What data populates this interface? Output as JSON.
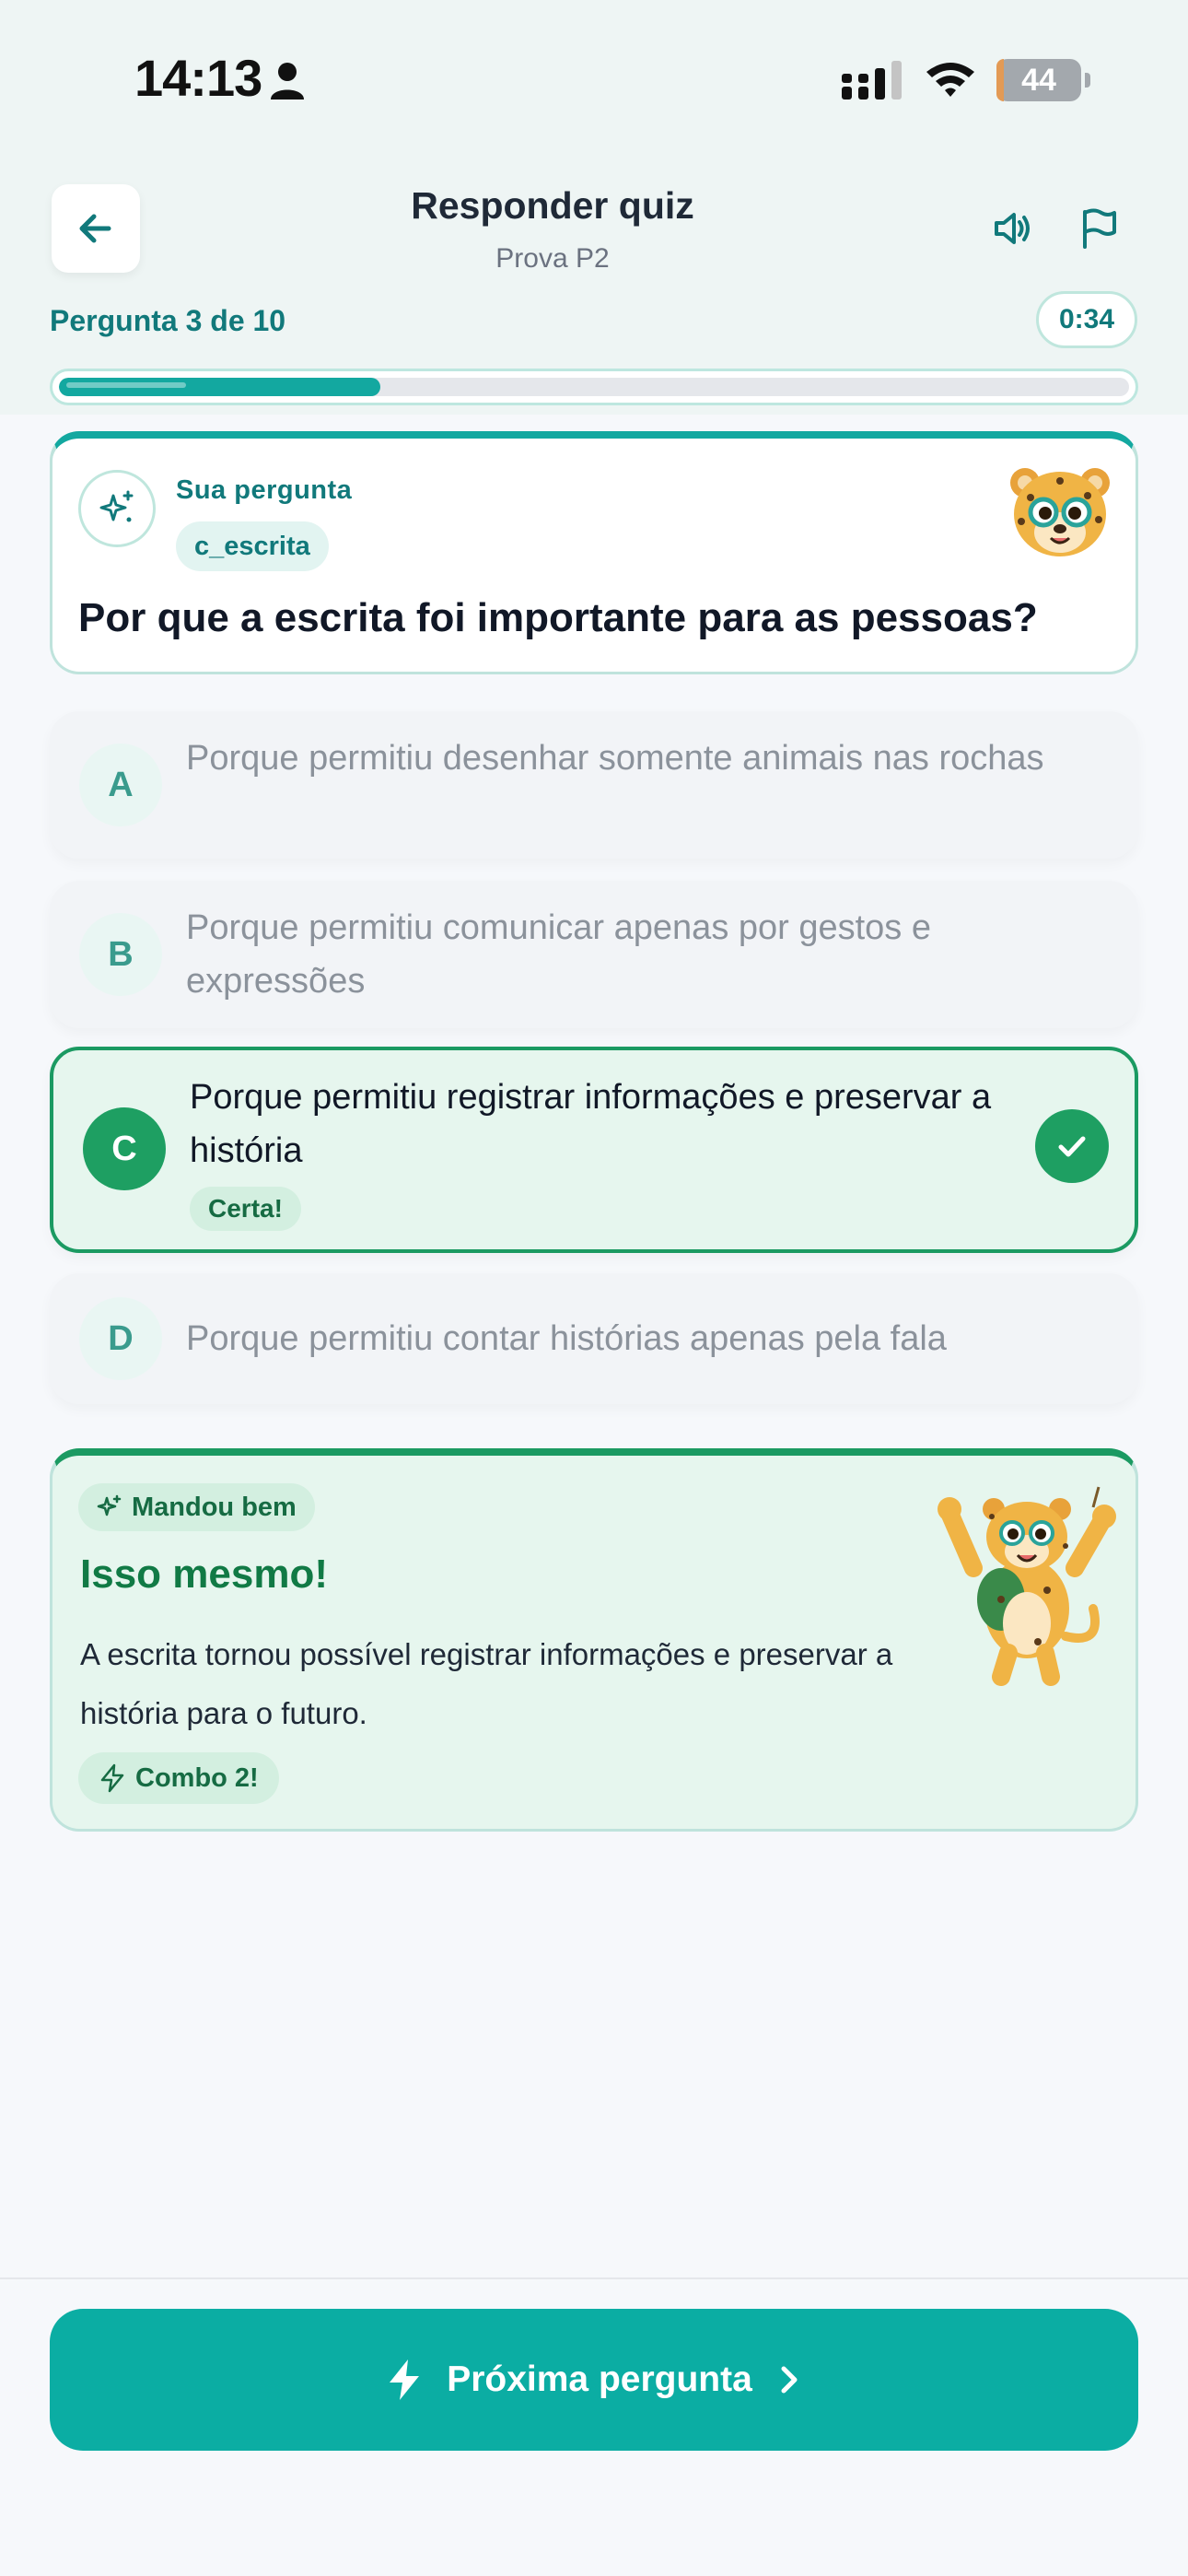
{
  "status_bar": {
    "time": "14:13",
    "battery": "44"
  },
  "header": {
    "title": "Responder quiz",
    "subtitle": "Prova P2",
    "progress_label": "Pergunta 3 de 10",
    "timer": "0:34",
    "progress_fraction": 0.3
  },
  "question": {
    "kicker": "Sua pergunta",
    "tag": "c_escrita",
    "text": "Por que a escrita foi importante para as pessoas?"
  },
  "options": [
    {
      "letter": "A",
      "text": "Porque permitiu desenhar somente animais nas rochas"
    },
    {
      "letter": "B",
      "text": "Porque permitiu comunicar apenas por gestos e expressões"
    },
    {
      "letter": "C",
      "text": "Porque permitiu registrar informações e preservar a história",
      "badge": "Certa!"
    },
    {
      "letter": "D",
      "text": "Porque permitiu contar histórias apenas pela fala"
    }
  ],
  "feedback": {
    "kicker": "Mandou bem",
    "title": "Isso mesmo!",
    "text": "A escrita tornou possível registrar informações e preservar a história para o futuro.",
    "combo": "Combo 2!"
  },
  "footer": {
    "next_label": "Próxima pergunta"
  },
  "colors": {
    "accent": "#0bada3",
    "correct": "#1e9f62",
    "teal_text": "#11797b"
  }
}
